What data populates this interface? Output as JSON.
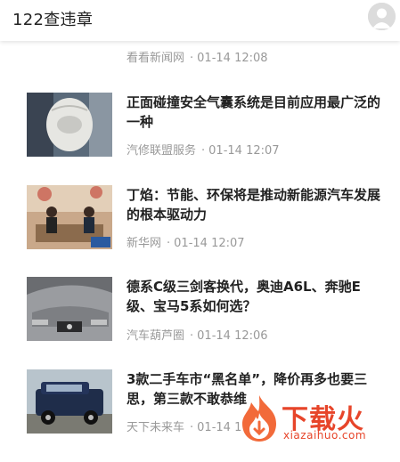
{
  "header": {
    "title": "122查违章",
    "avatar_icon": "user-avatar-icon"
  },
  "news": [
    {
      "title": "",
      "source": "看看新闻网",
      "time": "01-14 12:08"
    },
    {
      "title": "正面碰撞安全气囊系统是目前应用最广泛的一种",
      "source": "汽修联盟服务",
      "time": "01-14 12:07"
    },
    {
      "title": "丁焰：节能、环保将是推动新能源汽车发展的根本驱动力",
      "source": "新华网",
      "time": "01-14 12:07"
    },
    {
      "title": "德系C级三剑客换代，奥迪A6L、奔驰E级、宝马5系如何选？",
      "source": "汽车葫芦圈",
      "time": "01-14 12:06"
    },
    {
      "title": "3款二手车市“黑名单”，降价再多也要三思，第三款不敢恭维",
      "source": "天下未来车",
      "time": "01-14 1"
    }
  ],
  "watermark": {
    "text": "下载火",
    "sub": "xiazaihuo.com"
  },
  "colors": {
    "accent": "#e7452a",
    "title_text": "#222222",
    "meta_text": "#999999"
  }
}
